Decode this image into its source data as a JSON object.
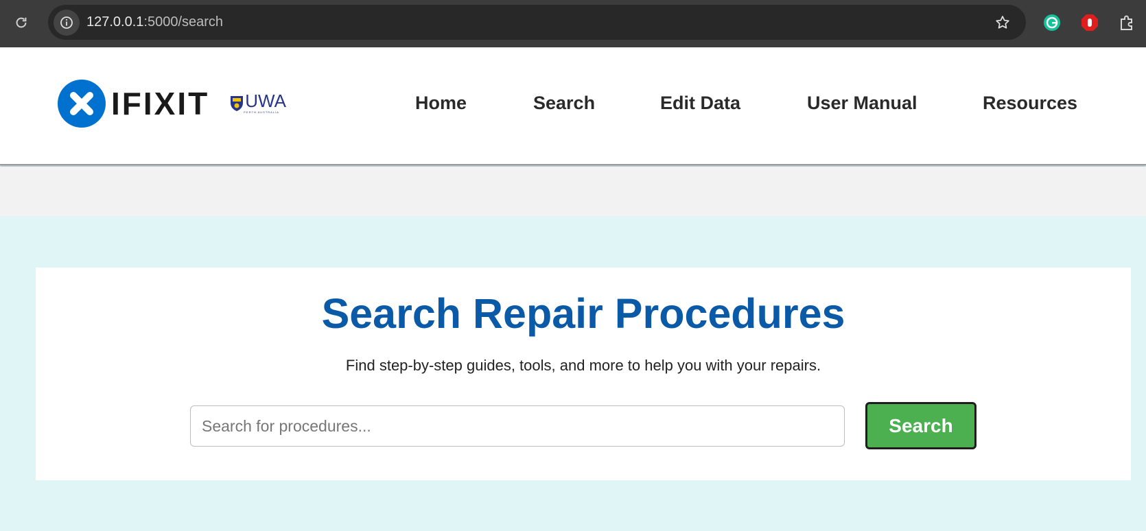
{
  "browser": {
    "url_host": "127.0.0.1",
    "url_path": ":5000/search"
  },
  "header": {
    "logo_text": "IFIXIT",
    "partner_logo_text": "UWA",
    "partner_logo_subtext": "PERTH AUSTRALIA",
    "nav": [
      {
        "label": "Home"
      },
      {
        "label": "Search"
      },
      {
        "label": "Edit Data"
      },
      {
        "label": "User Manual"
      },
      {
        "label": "Resources"
      }
    ]
  },
  "main": {
    "title": "Search Repair Procedures",
    "subtitle": "Find step-by-step guides, tools, and more to help you with your repairs.",
    "search_placeholder": "Search for procedures...",
    "search_value": "",
    "search_button_label": "Search"
  },
  "colors": {
    "brand_blue": "#0071ce",
    "title_blue": "#0a5aa8",
    "button_green": "#4caf50",
    "page_background": "#dff5f6"
  }
}
